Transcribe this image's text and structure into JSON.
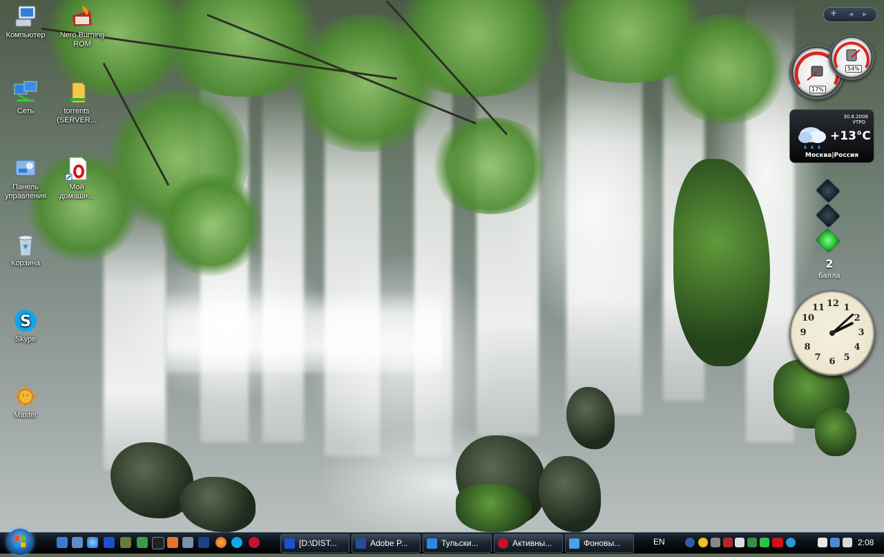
{
  "desktop_icons": [
    {
      "label": "Компьютер"
    },
    {
      "label": "Nero Burning ROM"
    },
    {
      "label": "Сеть"
    },
    {
      "label": "torrents (SERVER..."
    },
    {
      "label": "Панель управления"
    },
    {
      "label": "Мой домашн..."
    },
    {
      "label": "Корзина"
    },
    {
      "label": "Skype"
    },
    {
      "label": "Master"
    }
  ],
  "sidebar": {
    "controls": {
      "add": "+",
      "prev": "◀",
      "next": "▶"
    },
    "cpu_gauge": {
      "cpu": "17%",
      "memory": "54%"
    },
    "weather": {
      "date": "30.8.2008",
      "period": "УТРО",
      "temperature": "+13°C",
      "location": "Москва|Россия"
    },
    "traffic": {
      "score": "2",
      "unit": "балла"
    },
    "clock": {
      "numbers": [
        "12",
        "1",
        "2",
        "3",
        "4",
        "5",
        "6",
        "7",
        "8",
        "9",
        "10",
        "11"
      ],
      "time": "2:08"
    }
  },
  "taskbar": {
    "tasks": [
      {
        "label": "[D:\\DIST...",
        "icon": "far-manager-icon",
        "color": "#1f4fd0"
      },
      {
        "label": "Adobe P...",
        "icon": "photoshop-icon",
        "color": "#2a4a9a"
      },
      {
        "label": "Тульски...",
        "icon": "internet-explorer-icon",
        "color": "#2d8ae0"
      },
      {
        "label": "Активны...",
        "icon": "opera-icon",
        "color": "#c8102e"
      },
      {
        "label": "Фоновы...",
        "icon": "display-properties-icon",
        "color": "#4aa0e0"
      }
    ],
    "language": "EN",
    "clock": "2:08"
  },
  "colors": {
    "taskbar": "#0b1118",
    "accent": "#5ab0ff",
    "gauge_red": "#d7261e",
    "traffic_green": "#2fd33a"
  }
}
